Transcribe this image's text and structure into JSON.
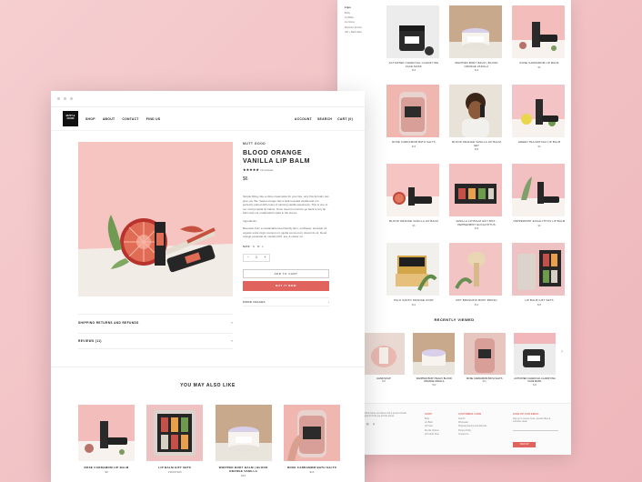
{
  "back": {
    "filter_title": "Lips",
    "filters": [
      "Body",
      "Lip Balm",
      "Lip Gloss",
      "Moisture Scrubs",
      "Gift + Bath Salts"
    ],
    "products": [
      {
        "name": "ACTIVATED CHARCOAL CLARIFYING FACE MASK",
        "price": "$16",
        "bg": "#ececec"
      },
      {
        "name": "WHIPPED BODY BALM | BLOOD ORANGE VANILLA",
        "price": "$19",
        "bg": "#c9a98c"
      },
      {
        "name": "ROSE CARDAMOM LIP BALM",
        "price": "$6",
        "bg": "#f3bdbc"
      },
      {
        "name": "ROSE CARDAMOM BATH SALTS",
        "price": "$16",
        "bg": "#f0b6b0"
      },
      {
        "name": "BLOOD ORANGE VANILLA LIP BALM SET",
        "price": "$18",
        "bg": "#e9e2d8"
      },
      {
        "name": "GREEN TEA MATCHA LIP BALM",
        "price": "$6",
        "bg": "#f4c3c6"
      },
      {
        "name": "BLOOD ORANGE VANILLA LIP BALM",
        "price": "$6",
        "bg": "#f6c4c2"
      },
      {
        "name": "VANILLA LIP BALM GIFT BOX - PEPPERMINT EUCALYPTUS",
        "price": "$18",
        "bg": "#f3c0bf"
      },
      {
        "name": "PEPPERMINT EUCALYPTUS LIP BALM",
        "price": "$6",
        "bg": "#f3c0c2"
      },
      {
        "name": "PALO SANTO ORANGE SOAP",
        "price": "$12",
        "bg": "#f1f0ec"
      },
      {
        "name": "DRY BRUSHING BODY BRUSH",
        "price": "$14",
        "bg": "#f3c4c4"
      },
      {
        "name": "LIP BALM GIFT SETS",
        "price": "$25",
        "bg": "#eec2c2"
      }
    ],
    "recent_title": "RECENTLY VIEWED",
    "recent": [
      {
        "name": "HAND SOAP",
        "price": "$12"
      },
      {
        "name": "WHIPPED BODY BALM | BLOOD ORANGE VANILLA",
        "price": "$19"
      },
      {
        "name": "ROSE CARDAMOM BATH SALTS",
        "price": "$16"
      },
      {
        "name": "ACTIVATED CHARCOAL CLARIFYING FACE MASK",
        "price": "$16"
      }
    ],
    "footer": {
      "col1_title": "SHOP",
      "col1": [
        "Body",
        "Lip Balm",
        "Gift Sets",
        "Bundle Options",
        "Gift Cards Here"
      ],
      "col2_title": "CUSTOMER CARE",
      "col2": [
        "Search",
        "Wholesale",
        "Shipping Returns and Refunds",
        "Privacy Policy",
        "Contact Us"
      ],
      "col3_title": "SIGN UP FOR EMAIL",
      "col3_text": "Sign up to receive news, special offers & exclusive deals.",
      "subscribe": "SIGN UP",
      "about_text": "At Mutt & Good, we believe that a product should be good for both you and the planet."
    }
  },
  "nav": {
    "logo": "MUTT & GOOD",
    "links": [
      "SHOP",
      "ABOUT",
      "CONTACT",
      "FIND US"
    ],
    "right": [
      "ACCOUNT",
      "SEARCH",
      "CART (0)"
    ]
  },
  "product": {
    "brand": "MUTT GOOD",
    "title": "BLOOD ORANGE VANILLA LIP BALM",
    "stars": "★★★★★",
    "review_count": "13 reviews",
    "price": "$6",
    "description": "Simple lifting, like a citrus creamsicle for your lips, only this lip balm can give you this. Sweet orange has a well-rounded vanilla and it is perfectly paired with notes of calming vanilla sweetness. This is one of our most popular lip balms. Once used it is hard to go back to any lip balm and our small-batch made in the stores.",
    "ingredients_label": "Ingredients:",
    "ingredients": "Beeswax from a sustainable bee-friendly farm, sunflower, avocado oil, organic extra virgin coconut oil, jojoba coconut oil, vitamin E oil, blood orange essential oil, vanilla CO2, tea, & castor oil.",
    "size_label": "SIZE",
    "sizes": [
      "S",
      "M",
      "L"
    ],
    "qty_minus": "−",
    "qty": "1",
    "qty_plus": "+",
    "add_to_cart": "ADD TO CART",
    "buy_now": "BUY IT NOW",
    "more_images": "MORE IMAGES",
    "more_images_icon": "›"
  },
  "accordions": [
    {
      "label": "SHIPPING RETURNS AND REFUNDS",
      "icon": "›"
    },
    {
      "label": "REVIEWS (11)",
      "icon": "›"
    }
  ],
  "related": {
    "title": "YOU MAY ALSO LIKE",
    "items": [
      {
        "name": "ROSE CARDAMOM LIP BALM",
        "price": "$6"
      },
      {
        "name": "LIP BALM GIFT SETS",
        "price": "FROM $25"
      },
      {
        "name": "WHIPPED BODY BALM | BLOOD ORANGE VANILLA",
        "price": "$19"
      },
      {
        "name": "ROSE CARDAMOM BATH SALTS",
        "price": "$16"
      }
    ]
  },
  "colors": {
    "accent": "#e0635e",
    "background": "#f3c6c8"
  }
}
